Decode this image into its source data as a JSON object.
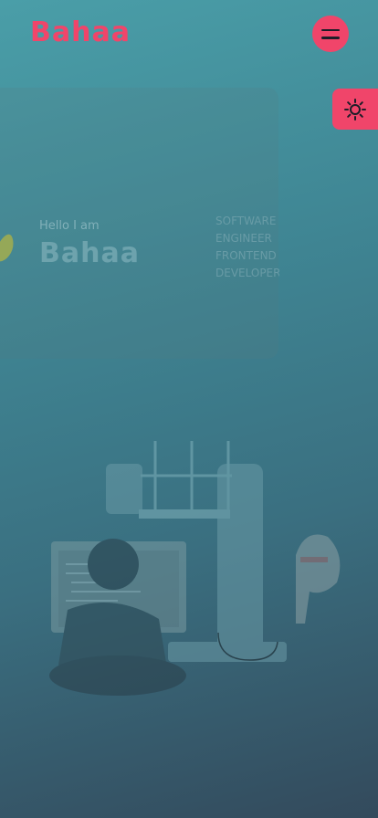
{
  "header": {
    "logo": "Bahaa",
    "menu_icon": "hamburger-icon",
    "theme_icon": "sun-icon"
  },
  "hero": {
    "greeting": "Hello I am",
    "name": "Bahaa",
    "roles": [
      "SOFTWARE",
      "ENGINEER",
      "FRONTEND",
      "DEVELOPER"
    ],
    "illustration": "developer-at-desk-illustration"
  },
  "colors": {
    "accent": "#f0456a",
    "bg_top": "#4a9ea8",
    "bg_bottom": "#334a5c"
  }
}
